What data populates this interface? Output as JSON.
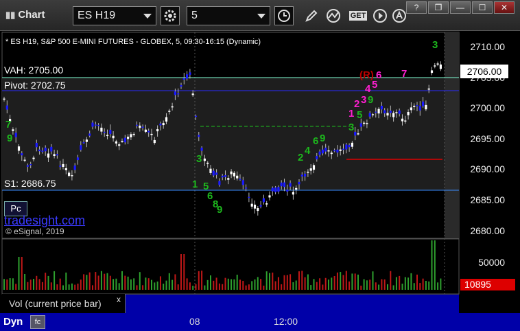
{
  "toolbar": {
    "title": "Chart",
    "symbol": "ES H19",
    "interval": "5",
    "get_label": "GET",
    "window_buttons": [
      "?",
      "❐",
      "—",
      "☐",
      "✕"
    ]
  },
  "chart": {
    "info_line": "* ES H19, S&P 500 E-MINI FUTURES - GLOBEX, 5, 09:30-16:15 (Dynamic)",
    "vah_label": "VAH: 2705.00",
    "pivot_label": "Pivot: 2702.75",
    "s1_label": "S1: 2686.75",
    "price_axis": [
      "2710.00",
      "2705.00",
      "2700.00",
      "2695.00",
      "2690.00",
      "2685.00",
      "2680.00"
    ],
    "current_price": "2706.00",
    "time_axis": [
      "08",
      "12:00"
    ],
    "pc_button": "Pc",
    "brand": "tradesight.com",
    "copyright": "© eSignal, 2019",
    "colors": {
      "up": "#ffffff",
      "down": "#1a1aff",
      "vah": "#7fffd4",
      "pivot": "#2a2aff",
      "s1": "#3a8cff"
    }
  },
  "volume": {
    "axis": [
      "50000"
    ],
    "current": "10895",
    "label": "Vol (current price bar)",
    "close": "x"
  },
  "footer": {
    "mode": "Dyn"
  },
  "indicators": {
    "magenta": [
      "1",
      "2",
      "3",
      "4",
      "5",
      "6",
      "7",
      "(R)"
    ],
    "green": [
      "1",
      "2",
      "3",
      "4",
      "5",
      "6",
      "7",
      "8",
      "9",
      "3"
    ]
  }
}
